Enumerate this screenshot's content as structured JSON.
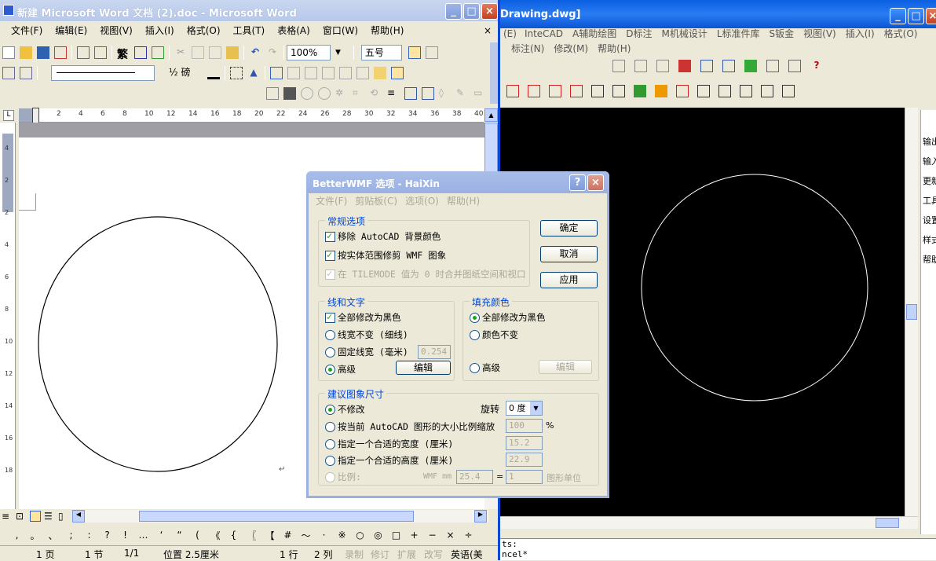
{
  "word": {
    "title": "新建 Microsoft Word 文档 (2).doc - Microsoft Word",
    "menu": [
      "文件(F)",
      "编辑(E)",
      "视图(V)",
      "插入(I)",
      "格式(O)",
      "工具(T)",
      "表格(A)",
      "窗口(W)",
      "帮助(H)"
    ],
    "close_x": "×",
    "zoom": "100%",
    "font_size": "五号",
    "line_weight": "½ 磅",
    "ruler_marks": [
      "2",
      "4",
      "6",
      "8",
      "10",
      "12",
      "14",
      "16",
      "18",
      "20",
      "22",
      "24",
      "26",
      "28",
      "30",
      "32",
      "34",
      "36",
      "38",
      "40"
    ],
    "vruler_marks": [
      "4",
      "2",
      "2",
      "4",
      "6",
      "8",
      "10",
      "12",
      "14",
      "16",
      "18"
    ],
    "symbols": [
      ",",
      "。",
      "、",
      ";",
      ":",
      "?",
      "!",
      "…",
      "‘",
      "“",
      "(",
      "《",
      "{",
      "〖",
      "【",
      "#",
      "～",
      "·",
      "※",
      "○",
      "◎",
      "□",
      "+",
      "−",
      "×",
      "÷"
    ],
    "status": {
      "page": "1 页",
      "section": "1 节",
      "pages": "1/1",
      "position": "位置 2.5厘米",
      "line": "1 行",
      "col": "2 列",
      "rec": "录制",
      "trk": "修订",
      "ext": "扩展",
      "ovr": "改写",
      "lang": "英语(美"
    }
  },
  "cad": {
    "title": "Drawing.dwg]",
    "menu1": [
      "(E)",
      "InteCAD",
      "A辅助绘图",
      "D标注",
      "M机械设计",
      "L标准件库",
      "S钣金",
      "视图(V)",
      "插入(I)",
      "格式(O)"
    ],
    "menu2": [
      "标注(N)",
      "修改(M)",
      "帮助(H)"
    ],
    "side": [
      "输出",
      "输入",
      "更新",
      "工具",
      "设置",
      "样式",
      "帮助"
    ],
    "cmd1": "ts:",
    "cmd2": "ncel*"
  },
  "dialog": {
    "title": "BetterWMF 选项 - HaiXin",
    "menu": [
      "文件(F)",
      "剪贴板(C)",
      "选项(O)",
      "帮助(H)"
    ],
    "general": {
      "title": "常规选项",
      "opt1": "移除 AutoCAD 背景颜色",
      "opt2": "按实体范围修剪 WMF 图象",
      "opt3": "在 TILEMODE 值为 0 时合并图纸空间和视口"
    },
    "ok": "确定",
    "cancel": "取消",
    "apply": "应用",
    "lines": {
      "title": "线和文字",
      "all_black": "全部修改为黑色",
      "keep": "线宽不变 (细线)",
      "fixed": "固定线宽 (毫米)",
      "fixed_val": "0.254",
      "adv": "高级",
      "edit": "编辑"
    },
    "fill": {
      "title": "填充颜色",
      "all_black": "全部修改为黑色",
      "keep": "颜色不变",
      "adv": "高级",
      "edit": "编辑"
    },
    "size": {
      "title": "建议图象尺寸",
      "nochange": "不修改",
      "rotate_label": "旋转",
      "rotate_val": "0 度",
      "scale": "按当前 AutoCAD 图形的大小比例缩放",
      "scale_val": "100",
      "pct": "%",
      "width": "指定一个合适的宽度 (厘米)",
      "width_val": "15.2",
      "height": "指定一个合适的高度 (厘米)",
      "height_val": "22.9",
      "ratio": "比例:",
      "wmf_mm": "WMF mm",
      "ratio_a": "25.4",
      "eq": "=",
      "ratio_b": "1",
      "unit": "图形单位"
    }
  }
}
